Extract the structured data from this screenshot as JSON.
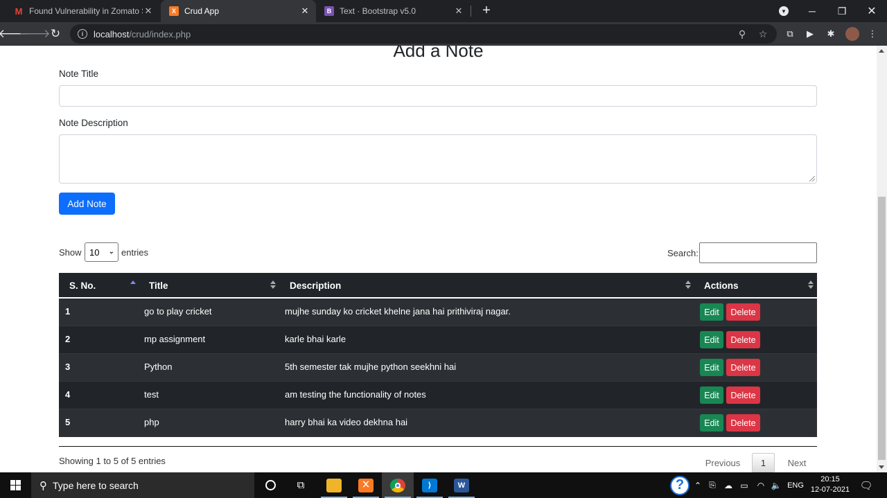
{
  "browser": {
    "tabs": [
      {
        "title": "Found Vulnerability in Zomato Sy",
        "favicon": "M",
        "favicon_color": "#ea4335",
        "active": false
      },
      {
        "title": "Crud App",
        "favicon": "X",
        "favicon_color": "#fb7a24",
        "active": true
      },
      {
        "title": "Text · Bootstrap v5.0",
        "favicon": "B",
        "favicon_color": "#7952b3",
        "active": false
      }
    ],
    "url_host": "localhost",
    "url_path": "/crud/index.php"
  },
  "form": {
    "heading": "Add a Note",
    "title_label": "Note Title",
    "title_value": "",
    "description_label": "Note Description",
    "description_value": "",
    "submit_label": "Add Note"
  },
  "datatable": {
    "show_label": "Show",
    "entries_label": "entries",
    "page_length": "10",
    "search_label": "Search:",
    "search_value": "",
    "columns": [
      "S. No.",
      "Title",
      "Description",
      "Actions"
    ],
    "rows": [
      {
        "sno": "1",
        "title": "go to play cricket",
        "description": "mujhe sunday ko cricket khelne jana hai prithiviraj nagar."
      },
      {
        "sno": "2",
        "title": "mp assignment",
        "description": "karle bhai karle"
      },
      {
        "sno": "3",
        "title": "Python",
        "description": "5th semester tak mujhe python seekhni hai"
      },
      {
        "sno": "4",
        "title": "test",
        "description": "am testing the functionality of notes"
      },
      {
        "sno": "5",
        "title": "php",
        "description": "harry bhai ka video dekhna hai"
      }
    ],
    "edit_label": "Edit",
    "delete_label": "Delete",
    "info": "Showing 1 to 5 of 5 entries",
    "prev_label": "Previous",
    "current_page": "1",
    "next_label": "Next"
  },
  "taskbar": {
    "search_placeholder": "Type here to search",
    "language": "ENG",
    "time": "20:15",
    "date": "12-07-2021"
  },
  "colors": {
    "primary": "#0d6efd",
    "success": "#198754",
    "danger": "#dc3545",
    "table_dark": "#212529"
  }
}
